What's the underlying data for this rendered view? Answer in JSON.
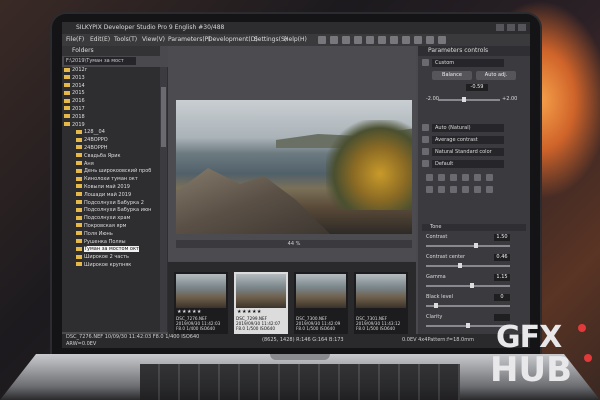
{
  "app": {
    "title": "SILKYPIX Developer Studio Pro 9 English",
    "counter": "#30/488"
  },
  "menu": [
    "File(F)",
    "Edit(E)",
    "Tools(T)",
    "View(V)",
    "Parameters(P)",
    "Development(D)",
    "Settings(S)",
    "Help(H)"
  ],
  "folders": {
    "header": "Folders",
    "path": "F:\\2019\\Туман за мост",
    "items": [
      {
        "label": "2012г"
      },
      {
        "label": "2013"
      },
      {
        "label": "2014"
      },
      {
        "label": "2015"
      },
      {
        "label": "2016"
      },
      {
        "label": "2017"
      },
      {
        "label": "2018"
      },
      {
        "label": "2019"
      },
      {
        "label": "128__04"
      },
      {
        "label": "24ВОРРО"
      },
      {
        "label": "24ВОРРН"
      },
      {
        "label": "Свадьба Ярик"
      },
      {
        "label": "Аня"
      },
      {
        "label": "День широкоовский проб"
      },
      {
        "label": "Кинолохи туман окт"
      },
      {
        "label": "Ковыли май 2019"
      },
      {
        "label": "Лошади май 2019"
      },
      {
        "label": "Подсолнухи Бабурка 2"
      },
      {
        "label": "Подсолнухи Бабурка июн"
      },
      {
        "label": "Подсолнухи храм"
      },
      {
        "label": "Покровская ярм"
      },
      {
        "label": "Поля Июнь"
      },
      {
        "label": "Рушенка Поляы"
      },
      {
        "label": "Туман за мостом окт",
        "selected": true
      },
      {
        "label": "Широкое 2 часть"
      },
      {
        "label": "Широкое крупняк"
      }
    ]
  },
  "preview": {
    "zoom": "44 %"
  },
  "thumbnails": [
    {
      "name": "DSC_7276.NEF",
      "date": "2019/09/30 11:42:03",
      "exif": "F8.0 1/400 ISO640",
      "stars": "★★★★★",
      "selected": false
    },
    {
      "name": "DSC_7299.NEF",
      "date": "2019/09/30 11:42:07",
      "exif": "F8.0 1/500 ISO640",
      "stars": "★★★★★",
      "selected": true
    },
    {
      "name": "DSC_7300.NEF",
      "date": "2019/09/30 11:42:09",
      "exif": "F8.0 1/500 ISO640",
      "stars": "",
      "selected": false
    },
    {
      "name": "DSC_7301.NEF",
      "date": "2019/09/30 11:43:12",
      "exif": "F8.0 1/500 ISO640",
      "stars": "",
      "selected": false
    }
  ],
  "status": {
    "left": "DSC_7276.NEF 10/09/30 11:42:03 F8.0 1/400 ISO640",
    "left2": "ARW=0.0EV",
    "center": "(8625, 1428) R:146 G:164 B:173",
    "right": "0.0EV 4x4Pattern:f=18.0mm"
  },
  "params": {
    "header": "Parameters controls",
    "preset": "Custom",
    "balance_btn": "Balance",
    "auto_btn": "Auto adj.",
    "exposure_value": "-0.59",
    "exposure_min": "-2.00",
    "exposure_max": "+2.00",
    "wb": "Auto (Natural)",
    "contrast_preset": "Average contrast",
    "color_preset": "Natural Standard color",
    "sharp_preset": "Default",
    "tone_section": "Tone",
    "sliders": [
      {
        "label": "Contrast",
        "value": "1.50",
        "level": 0.6
      },
      {
        "label": "Contrast center",
        "value": "0.46",
        "level": 0.4
      },
      {
        "label": "Gamma",
        "value": "1.15",
        "level": 0.55
      },
      {
        "label": "Black level",
        "value": "0",
        "level": 0.1
      },
      {
        "label": "Clarity",
        "value": "",
        "level": 0.5
      }
    ]
  },
  "watermark": {
    "top": "GFX",
    "bottom": "HUB"
  }
}
